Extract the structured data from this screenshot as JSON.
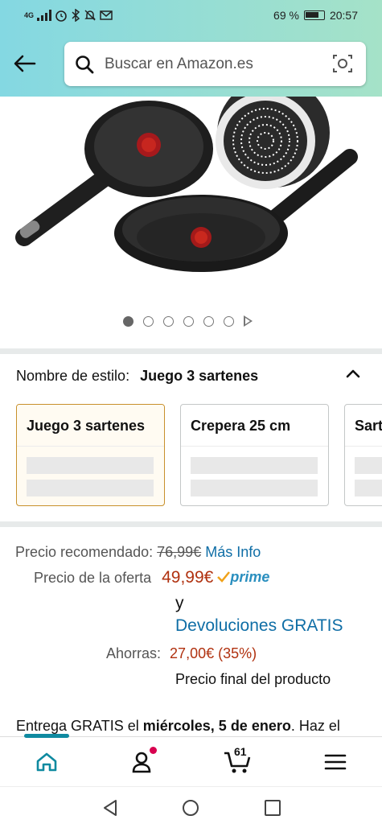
{
  "status_bar": {
    "network": "4G",
    "battery": "69 %",
    "time": "20:57"
  },
  "header": {
    "back_icon": "arrow-left-icon",
    "search_placeholder": "Buscar en Amazon.es",
    "camera_icon": "camera-scan-icon"
  },
  "gallery": {
    "total_dots": 6,
    "active_index": 0,
    "has_video": true
  },
  "style_selector": {
    "label": "Nombre de estilo:",
    "selected": "Juego 3 sartenes",
    "options": [
      {
        "label": "Juego 3 sartenes",
        "selected": true
      },
      {
        "label": "Crepera 25 cm",
        "selected": false
      },
      {
        "label": "Sart",
        "selected": false
      }
    ]
  },
  "price": {
    "recommended_label": "Precio recomendado:",
    "recommended_value": "76,99€",
    "more_info": "Más Info",
    "offer_label": "Precio de la oferta",
    "offer_value": "49,99€",
    "prime": "prime",
    "and": "y",
    "free_returns": "Devoluciones GRATIS",
    "savings_label": "Ahorras:",
    "savings_value": "27,00€ (35%)",
    "final_price_note": "Precio final del producto"
  },
  "delivery": {
    "prefix": "Entrega GRATIS el",
    "date": "miércoles, 5 de enero",
    "suffix": ". Haz el"
  },
  "bottom_nav": {
    "cart_count": "61"
  },
  "colors": {
    "header_gradient_start": "#84d8e2",
    "header_gradient_end": "#a5e2c8",
    "link": "#0f6ea6",
    "price_red": "#b0310f",
    "selected_border": "#c8902b",
    "nav_accent": "#0f8aa0"
  }
}
